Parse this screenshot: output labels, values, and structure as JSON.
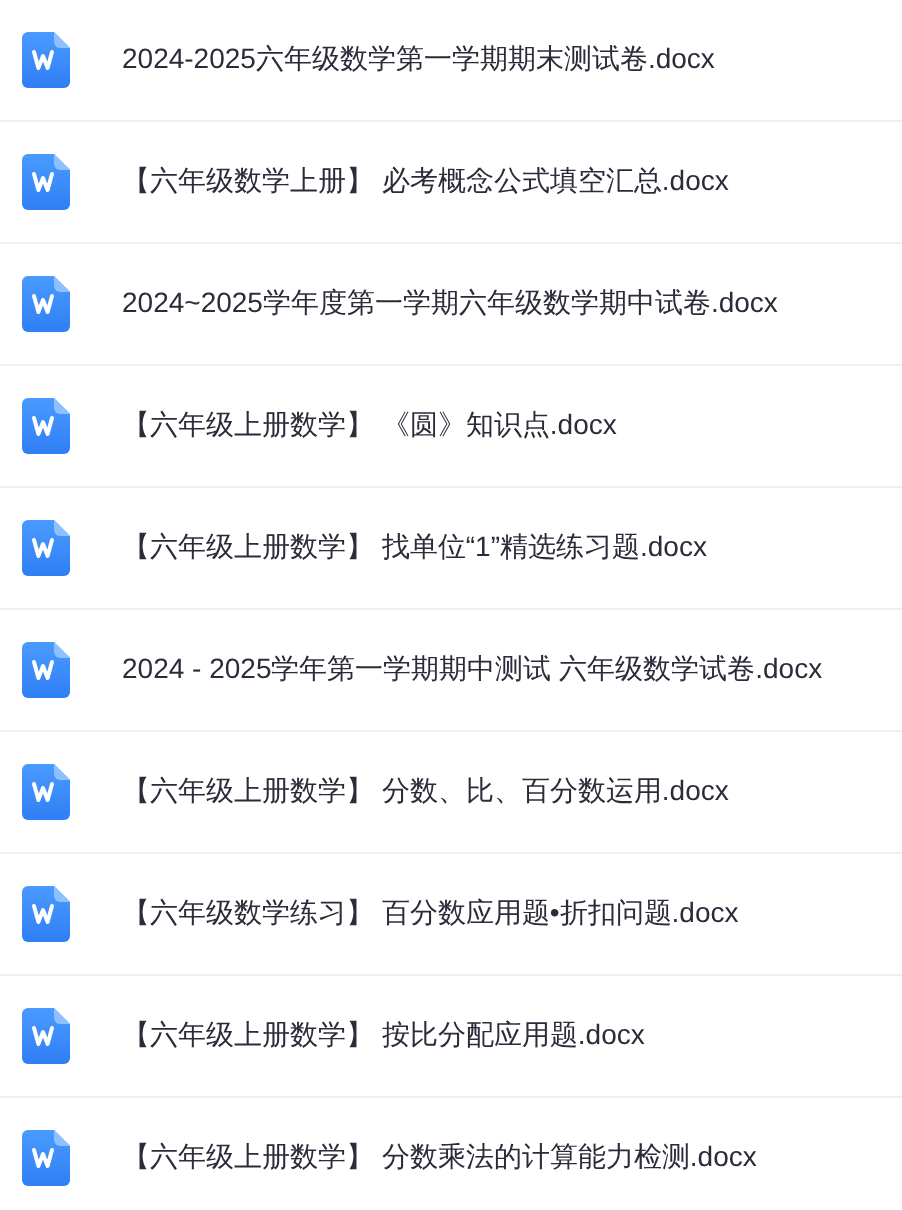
{
  "files": [
    {
      "name": "2024-2025六年级数学第一学期期末测试卷.docx",
      "kind": "word"
    },
    {
      "name": "【六年级数学上册】 必考概念公式填空汇总.docx",
      "kind": "word"
    },
    {
      "name": "2024~2025学年度第一学期六年级数学期中试卷.docx",
      "kind": "word"
    },
    {
      "name": "【六年级上册数学】 《圆》知识点.docx",
      "kind": "word"
    },
    {
      "name": "【六年级上册数学】 找单位“1”精选练习题.docx",
      "kind": "word"
    },
    {
      "name": "2024 - 2025学年第一学期期中测试 六年级数学试卷.docx",
      "kind": "word"
    },
    {
      "name": "【六年级上册数学】 分数、比、百分数运用.docx",
      "kind": "word"
    },
    {
      "name": "【六年级数学练习】 百分数应用题•折扣问题.docx",
      "kind": "word"
    },
    {
      "name": "【六年级上册数学】 按比分配应用题.docx",
      "kind": "word"
    },
    {
      "name": "【六年级上册数学】 分数乘法的计算能力检测.docx",
      "kind": "word"
    }
  ]
}
